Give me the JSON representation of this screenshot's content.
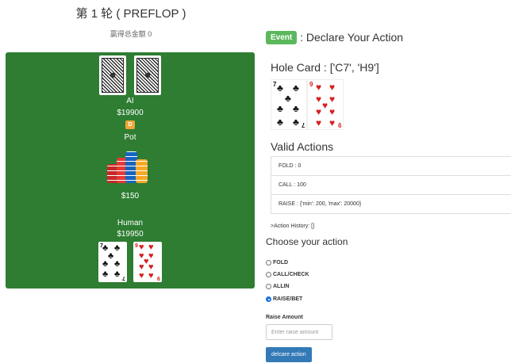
{
  "round": {
    "title": "第 1 轮 ( PREFLOP )",
    "win_total": "赢得总金额 0"
  },
  "table": {
    "ai": {
      "name": "AI",
      "stack": "$19900",
      "dealer_badge": "D"
    },
    "pot": {
      "label": "Pot",
      "amount": "$150"
    },
    "human": {
      "name": "Human",
      "stack": "$19950",
      "cards": [
        {
          "rank": "7",
          "suit": "♣",
          "color": "#111111"
        },
        {
          "rank": "9",
          "suit": "♥",
          "color": "#d61f1f"
        }
      ]
    }
  },
  "panel": {
    "event_badge": "Event",
    "event_title": ": Declare Your Action",
    "hole_card_title": "Hole Card : ['C7', 'H9']",
    "hole_cards": [
      {
        "rank": "7",
        "suit": "♣",
        "color": "#111111"
      },
      {
        "rank": "9",
        "suit": "♥",
        "color": "#d61f1f"
      }
    ],
    "valid_actions_title": "Valid Actions",
    "valid_actions": [
      "FOLD : 0",
      "CALL : 100",
      "RAISE : {'min': 200, 'max': 20000}"
    ],
    "action_history": ">Action History: []",
    "choose_title": "Choose your action",
    "options": [
      {
        "label": "FOLD",
        "checked": false
      },
      {
        "label": "CALL/CHECK",
        "checked": false
      },
      {
        "label": "ALLIN",
        "checked": false
      },
      {
        "label": "RAISE/BET",
        "checked": true
      }
    ],
    "raise_label": "Raise Amount",
    "raise_placeholder": "Enter raise amount",
    "raise_value": "",
    "submit_label": "delcare action"
  },
  "colors": {
    "table_green": "#2e7d32",
    "event_green": "#5cb85c",
    "button_blue": "#337ab7",
    "dealer_orange": "#f0a63a"
  }
}
